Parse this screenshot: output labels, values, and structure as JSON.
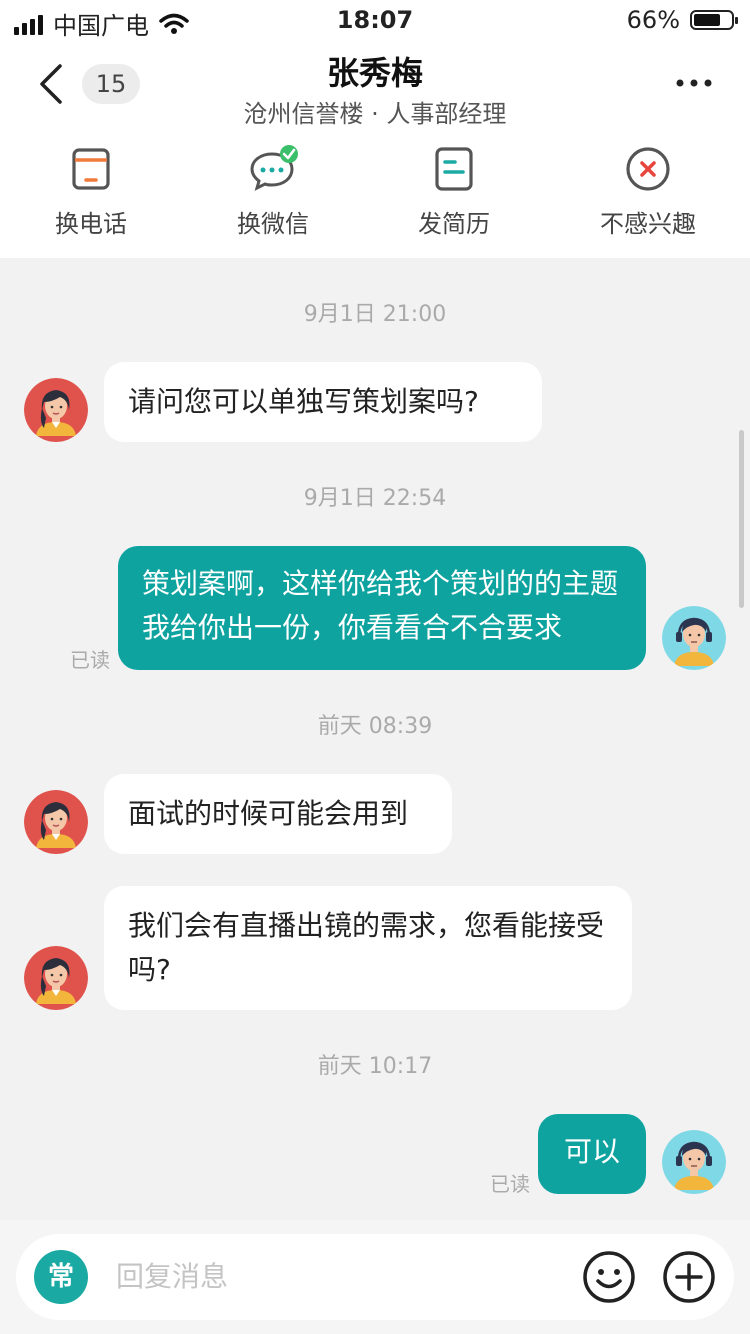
{
  "status_bar": {
    "carrier": "中国广电",
    "time": "18:07",
    "battery_percent": "66%",
    "battery_level": 0.66
  },
  "header": {
    "unread_count": "15",
    "contact_name": "张秀梅",
    "contact_subtitle": "沧州信誉楼 · 人事部经理",
    "actions": [
      {
        "label": "换电话",
        "icon": "phone-swap-icon"
      },
      {
        "label": "换微信",
        "icon": "wechat-swap-icon"
      },
      {
        "label": "发简历",
        "icon": "resume-icon"
      },
      {
        "label": "不感兴趣",
        "icon": "not-interested-icon"
      }
    ]
  },
  "messages": {
    "ts1": "9月1日 21:00",
    "m1": "请问您可以单独写策划案吗?",
    "ts2": "9月1日 22:54",
    "m2": "策划案啊，这样你给我个策划的的主题我给你出一份，你看看合不合要求",
    "m2_status": "已读",
    "ts3": "前天 08:39",
    "m3": "面试的时候可能会用到",
    "m4": "我们会有直播出镜的需求，您看能接受吗?",
    "ts4": "前天 10:17",
    "m5": "可以",
    "m5_status": "已读"
  },
  "input": {
    "quick_phrase_label": "常",
    "placeholder": "回复消息"
  },
  "colors": {
    "accent": "#0fa3a0",
    "reject_red": "#e8453c",
    "resume_teal": "#1ba9a3",
    "phone_orange": "#f07a3a"
  }
}
